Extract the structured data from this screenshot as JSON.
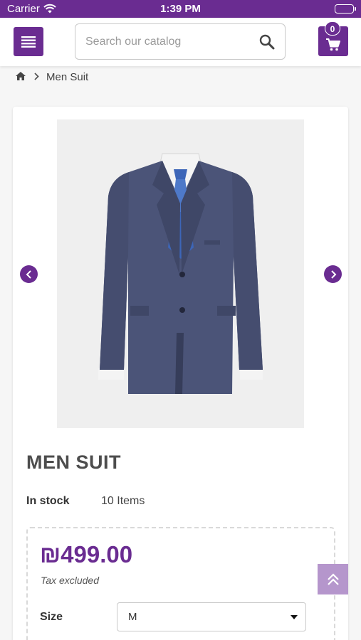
{
  "status_bar": {
    "carrier": "Carrier",
    "time": "1:39 PM"
  },
  "header": {
    "menu_icon": "hamburger-menu-icon",
    "search": {
      "placeholder": "Search our catalog",
      "value": ""
    },
    "cart": {
      "count": "0"
    }
  },
  "breadcrumb": {
    "items": [
      "Men Suit"
    ]
  },
  "product": {
    "name": "MEN SUIT",
    "stock_label": "In stock",
    "stock_value": "10 Items",
    "price": "₪499.00",
    "tax_note": "Tax excluded",
    "size_label": "Size",
    "size_selected": "M"
  },
  "colors": {
    "brand": "#6a2c91",
    "scroll_top": "#b596cc"
  }
}
